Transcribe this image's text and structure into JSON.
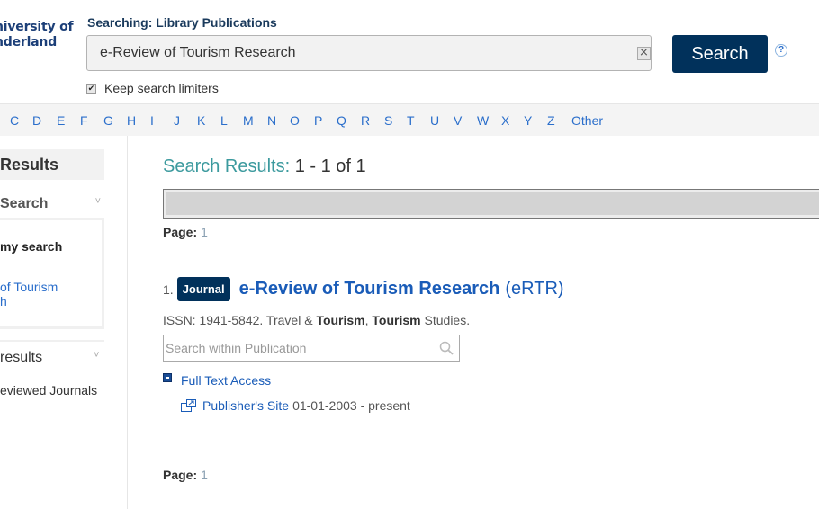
{
  "header": {
    "logo_lines": [
      "niversity of",
      "nderland"
    ],
    "searching_label": "Searching: Library Publications",
    "search_value": "e-Review of Tourism Research",
    "clear_icon": "×",
    "search_button": "Search",
    "help_icon": "?",
    "keep_limiters_label": "Keep search limiters",
    "keep_limiters_checked": true
  },
  "alphabet": [
    "C",
    "D",
    "E",
    "F",
    "G",
    "H",
    "I",
    "J",
    "K",
    "L",
    "M",
    "N",
    "O",
    "P",
    "Q",
    "R",
    "S",
    "T",
    "U",
    "V",
    "W",
    "X",
    "Y",
    "Z",
    "Other"
  ],
  "sidebar": {
    "results_heading": "Results",
    "search_section": "Search",
    "my_search_label": "my search",
    "my_search_link": [
      "of Tourism",
      "h"
    ],
    "results_section": "results",
    "journals_item": "eviewed Journals",
    "chevron": "˅"
  },
  "main": {
    "results_label": "Search Results:",
    "results_count": "1 - 1 of 1",
    "page_label": "Page:",
    "page_number": "1",
    "result": {
      "number": "1.",
      "badge": "Journal",
      "title": "e-Review of Tourism Research",
      "abbr": "(eRTR)",
      "issn_prefix": "ISSN: 1941-5842. Travel & ",
      "subject_bold1": "Tourism",
      "sep": ", ",
      "subject_bold2": "Tourism",
      "issn_suffix": " Studies.",
      "search_placeholder": "Search within Publication",
      "full_text_label": "Full Text Access",
      "publisher_link": "Publisher's Site",
      "coverage": "01-01-2003 - present"
    }
  },
  "colors": {
    "brand_navy": "#01315b",
    "link_blue": "#1a5cb8",
    "teal_heading": "#3c9a9e"
  }
}
